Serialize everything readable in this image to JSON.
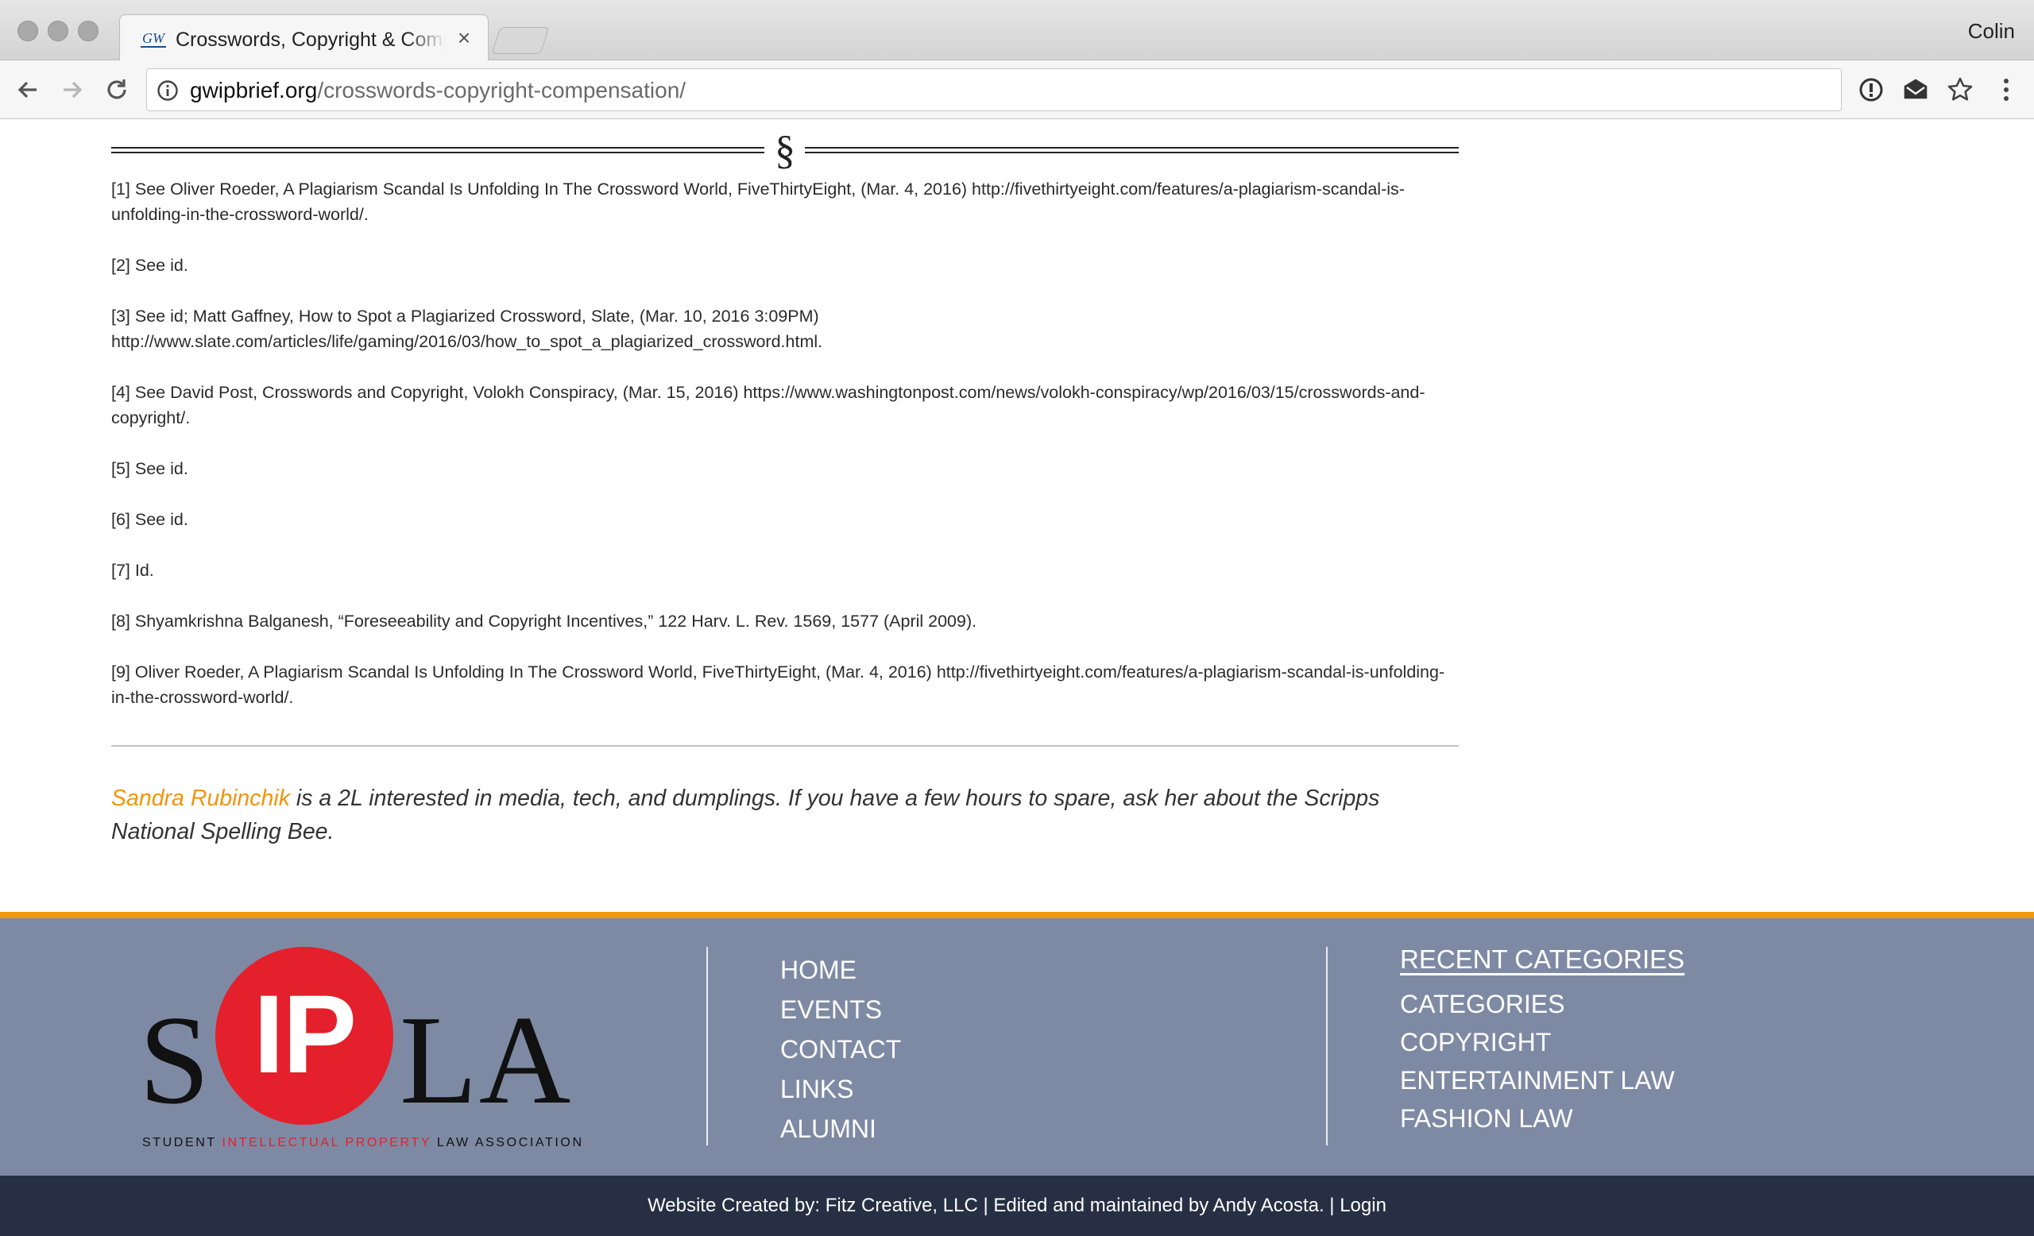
{
  "browser": {
    "tab_title": "Crosswords, Copyright & Compensation",
    "tab_favicon": "GW",
    "tab_close": "×",
    "profile_name": "Colin",
    "url_host": "gwipbrief.org",
    "url_path": "/crosswords-copyright-compensation/",
    "icons": [
      "back-arrow-icon",
      "forward-arrow-icon",
      "reload-icon",
      "info-icon",
      "password-key-icon",
      "mail-icon",
      "bookmark-star-icon",
      "menu-dots-icon"
    ]
  },
  "article": {
    "section_mark": "§",
    "footnotes": [
      "[1] See Oliver Roeder, A Plagiarism Scandal Is Unfolding In The Crossword World, FiveThirtyEight, (Mar. 4, 2016) http://fivethirtyeight.com/features/a-plagiarism-scandal-is-unfolding-in-the-crossword-world/.",
      "[2] See id.",
      "[3] See id; Matt Gaffney, How to Spot a Plagiarized Crossword, Slate, (Mar. 10, 2016 3:09PM) http://www.slate.com/articles/life/gaming/2016/03/how_to_spot_a_plagiarized_crossword.html.",
      "[4] See David Post, Crosswords and Copyright, Volokh Conspiracy, (Mar. 15, 2016) https://www.washingtonpost.com/news/volokh-conspiracy/wp/2016/03/15/crosswords-and-copyright/.",
      "[5] See id.",
      "[6] See id.",
      "[7] Id.",
      "[8] Shyamkrishna Balganesh, “Foreseeability and Copyright Incentives,” 122 Harv. L. Rev. 1569, 1577 (April 2009).",
      "[9] Oliver Roeder, A Plagiarism Scandal Is Unfolding In The Crossword World, FiveThirtyEight, (Mar. 4, 2016) http://fivethirtyeight.com/features/a-plagiarism-scandal-is-unfolding-in-the-crossword-world/."
    ],
    "bio_author": "Sandra Rubinchik",
    "bio_text": " is a 2L interested in media, tech, and dumplings. If you have a few hours to spare, ask her about the Scripps National Spelling Bee."
  },
  "footer": {
    "logo": {
      "letter_s": "S",
      "letters_ip": "IP",
      "letters_la": "LA",
      "tagline_1": "STUDENT ",
      "tagline_2": "INTELLECTUAL PROPERTY",
      "tagline_3": " LAW ASSOCIATION"
    },
    "nav": [
      "HOME",
      "EVENTS",
      "CONTACT",
      "LINKS",
      "ALUMNI"
    ],
    "recent_categories_heading": "RECENT CATEGORIES",
    "categories": [
      "CATEGORIES",
      "COPYRIGHT",
      "ENTERTAINMENT LAW",
      "FASHION LAW"
    ],
    "credits": "Website Created by: Fitz Creative, LLC | Edited and maintained by Andy Acosta. | Login"
  },
  "colors": {
    "accent_orange": "#f4980d",
    "author_orange": "#f2930c",
    "footer_bg": "#7e8aa4",
    "credits_bg": "#262f43",
    "logo_red": "#e3202b"
  }
}
